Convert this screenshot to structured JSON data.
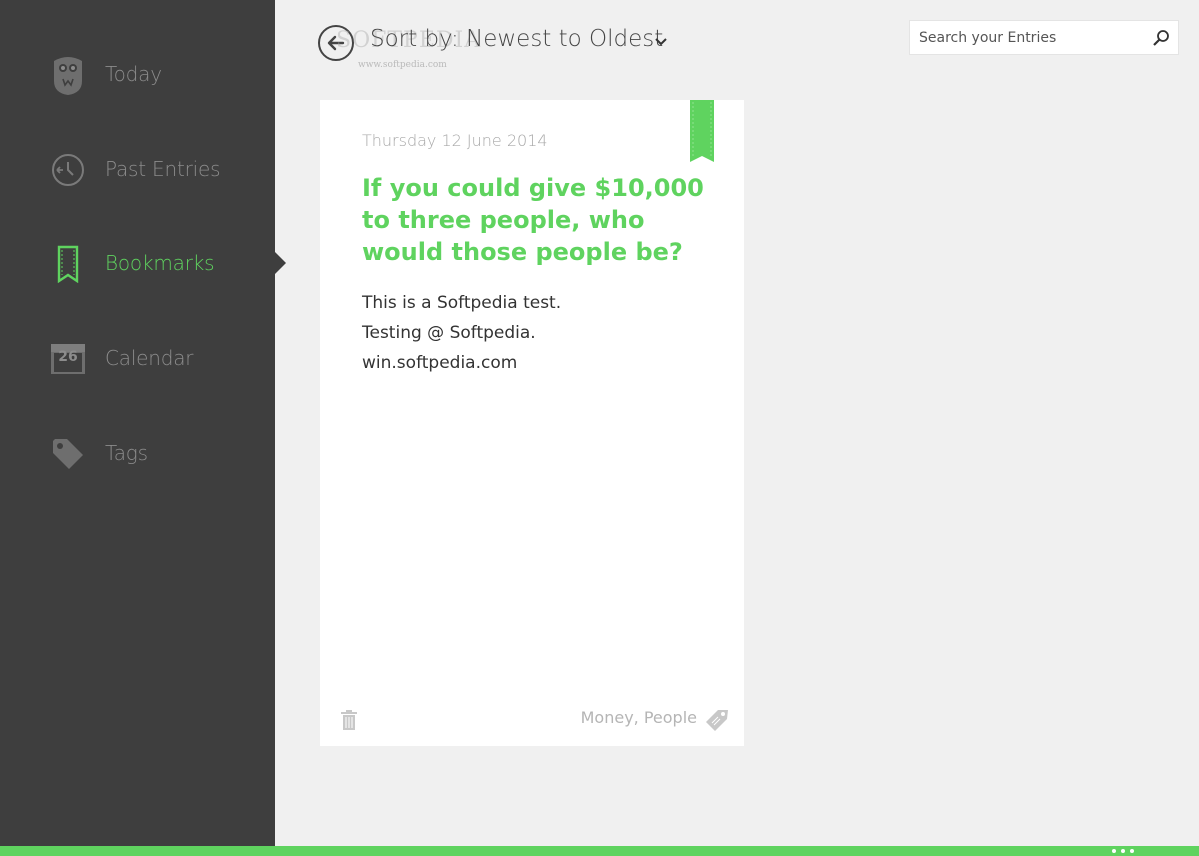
{
  "sidebar": {
    "items": [
      {
        "label": "Today",
        "icon": "owl-icon"
      },
      {
        "label": "Past Entries",
        "icon": "clock-back-icon"
      },
      {
        "label": "Bookmarks",
        "icon": "bookmark-icon",
        "active": true
      },
      {
        "label": "Calendar",
        "icon": "calendar-icon",
        "day": "26"
      },
      {
        "label": "Tags",
        "icon": "tag-icon"
      }
    ]
  },
  "header": {
    "sort_label": "Sort by:",
    "sort_value": "Newest to Oldest",
    "watermark": "SOFTPEDIA",
    "watermark_url": "www.softpedia.com"
  },
  "search": {
    "placeholder": "Search your Entries"
  },
  "entry": {
    "date": "Thursday 12 June 2014",
    "title": "If you could give $10,000 to three people, who would those people be?",
    "body_lines": [
      "This is a Softpedia test.",
      "Testing @ Softpedia.",
      "win.softpedia.com"
    ],
    "tags": "Money, People",
    "bookmarked": true
  },
  "colors": {
    "accent": "#5fd35f",
    "sidebar_bg": "#3e3e3e",
    "content_bg": "#f0f0f0",
    "inactive_text": "#8c8c8c"
  }
}
